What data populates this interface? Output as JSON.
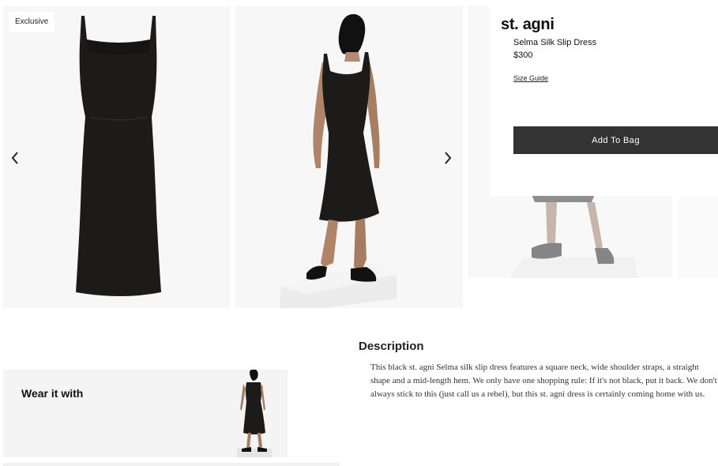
{
  "gallery": {
    "badge": "Exclusive",
    "prev_icon": "chevron-left-icon",
    "next_icon": "chevron-right-icon"
  },
  "product": {
    "brand": "st. agni",
    "name": "Selma Silk Slip Dress",
    "price": "$300",
    "size_guide": "Size Guide",
    "add_to_bag": "Add To Bag"
  },
  "description": {
    "heading": "Description",
    "text": "This black st. agni Selma silk slip dress features a square neck, wide shoulder straps, a straight shape and a mid-length hem. We only have one shopping rule: If it's not black, put it back. We don't always stick to this (just call us a rebel), but this st. agni dress is certainly coming home with us."
  },
  "wear_it_with": {
    "title": "Wear it with"
  },
  "colors": {
    "button_bg": "#333333",
    "panel_bg": "#f7f7f7",
    "dress": "#1c1a19"
  }
}
